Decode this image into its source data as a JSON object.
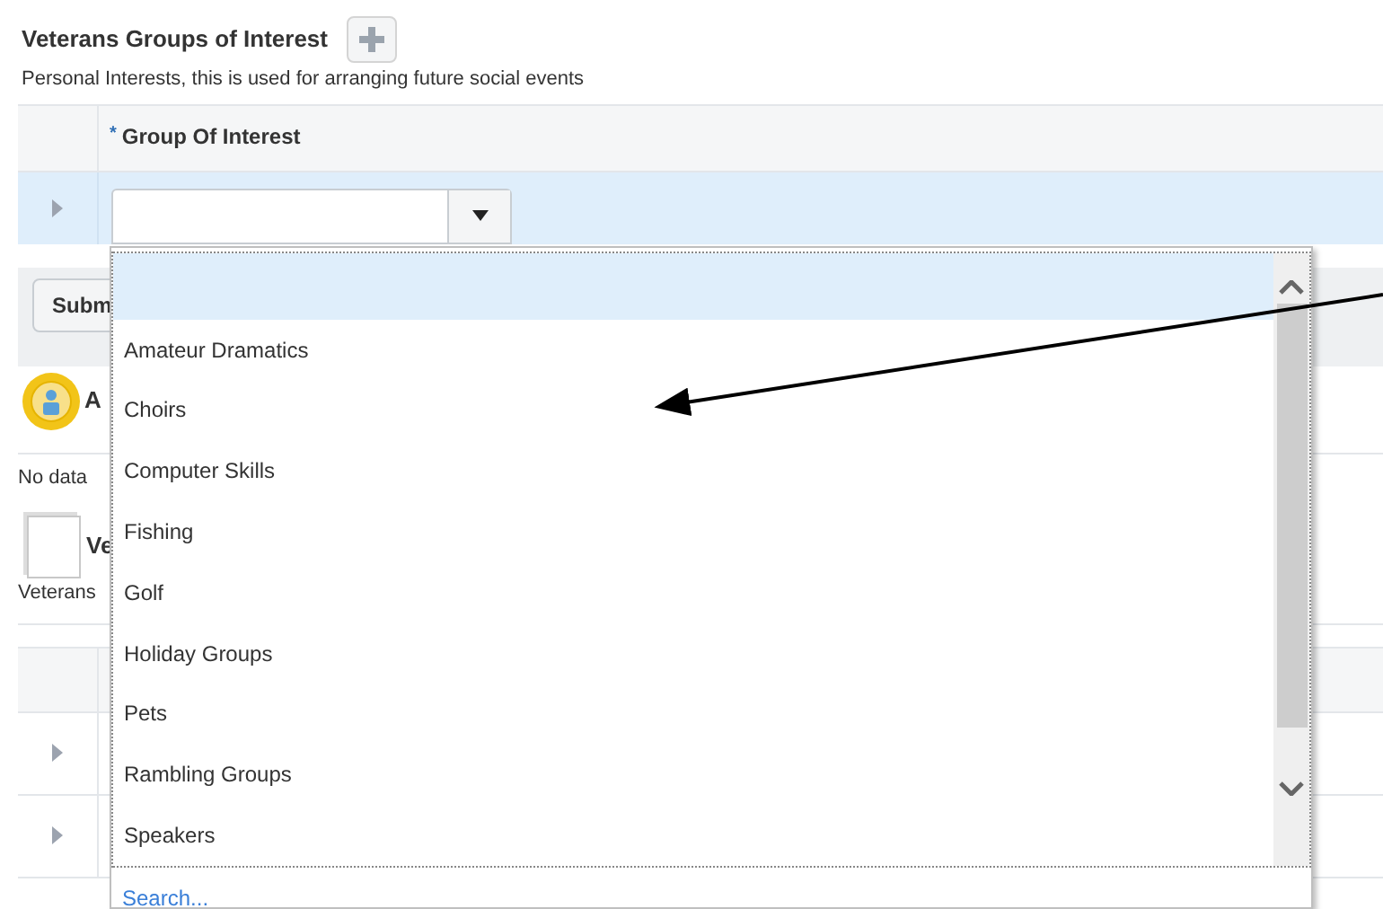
{
  "section": {
    "title": "Veterans Groups of Interest",
    "description": "Personal Interests, this is used for arranging future social events"
  },
  "table": {
    "columns": [
      {
        "label": "Group Of Interest",
        "required_mark": "*"
      }
    ],
    "row_expanded": false
  },
  "submit_button": {
    "label": "Subm"
  },
  "awards": {
    "heading": "A",
    "message": "No data"
  },
  "veterans": {
    "heading": "Ve",
    "description": "Veterans"
  },
  "table2": {
    "rows": [
      {
        "expanded": false
      },
      {
        "expanded": false
      }
    ]
  },
  "dropdown": {
    "blank_option_highlighted": true,
    "options": [
      {
        "label": "Amateur Dramatics"
      },
      {
        "label": "Choirs"
      },
      {
        "label": "Computer Skills"
      },
      {
        "label": "Fishing"
      },
      {
        "label": "Golf"
      },
      {
        "label": "Holiday Groups"
      },
      {
        "label": "Pets"
      },
      {
        "label": "Rambling Groups"
      },
      {
        "label": "Speakers"
      }
    ],
    "search_link": "Search..."
  }
}
